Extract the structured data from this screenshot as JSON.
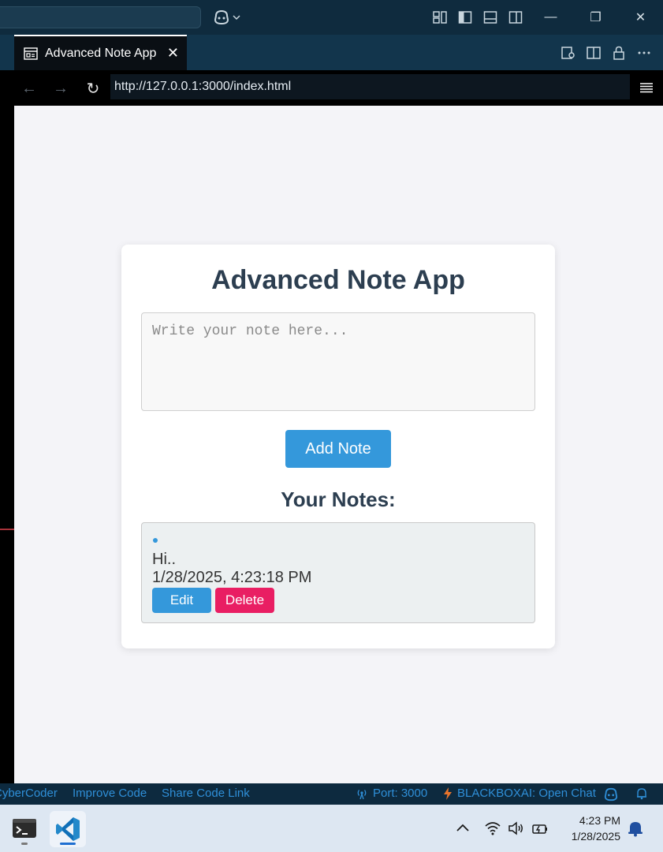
{
  "window": {
    "tab_title": "Advanced Note App",
    "tab_close": "✕",
    "minimize": "—",
    "restore": "❐",
    "close": "✕"
  },
  "browser": {
    "back": "←",
    "forward": "→",
    "reload": "↻",
    "url": "http://127.0.0.1:3000/index.html"
  },
  "app": {
    "title": "Advanced Note App",
    "note_placeholder": "Write your note here...",
    "add_button": "Add Note",
    "notes_heading": "Your Notes:",
    "notes": [
      {
        "text": "Hi..",
        "timestamp": "1/28/2025, 4:23:18 PM",
        "edit_label": "Edit",
        "delete_label": "Delete"
      }
    ]
  },
  "statusbar": {
    "items": [
      "CyberCoder",
      "Improve Code",
      "Share Code Link"
    ],
    "port": "Port: 3000",
    "blackbox": "BLACKBOXAI: Open Chat"
  },
  "taskbar": {
    "time": "4:23 PM",
    "date": "1/28/2025"
  },
  "colors": {
    "accent": "#3498db",
    "delete": "#e91e63",
    "heading": "#2c3e50",
    "statusbar_text": "#2f8fd8"
  }
}
